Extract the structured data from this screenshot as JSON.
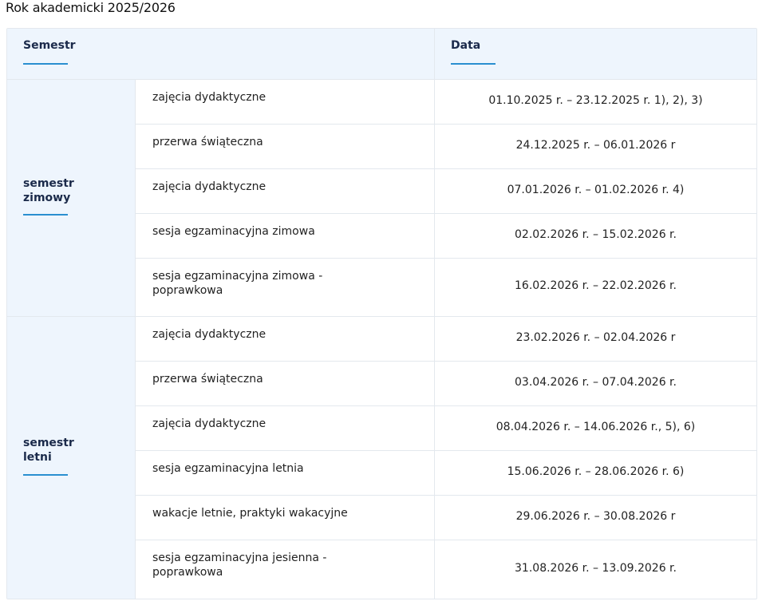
{
  "page_title": "Rok akademicki 2025/2026",
  "table": {
    "headers": {
      "semestr": "Semestr",
      "data": "Data"
    },
    "semesters": [
      {
        "name": "semestr\nzimowy",
        "rows": [
          {
            "activity": "zajęcia dydaktyczne",
            "date": "01.10.2025 r. – 23.12.2025 r. 1), 2), 3)"
          },
          {
            "activity": "przerwa świąteczna",
            "date": "24.12.2025 r. – 06.01.2026 r"
          },
          {
            "activity": "zajęcia dydaktyczne",
            "date": "07.01.2026 r. – 01.02.2026 r. 4)"
          },
          {
            "activity": "sesja egzaminacyjna zimowa",
            "date": "02.02.2026 r. – 15.02.2026 r."
          },
          {
            "activity": "sesja egzaminacyjna zimowa - poprawkowa",
            "date": "16.02.2026 r. – 22.02.2026 r."
          }
        ]
      },
      {
        "name": "semestr\nletni",
        "rows": [
          {
            "activity": "zajęcia dydaktyczne",
            "date": "23.02.2026 r. – 02.04.2026 r"
          },
          {
            "activity": "przerwa świąteczna",
            "date": "03.04.2026 r. – 07.04.2026 r."
          },
          {
            "activity": "zajęcia dydaktyczne",
            "date": "08.04.2026 r. – 14.06.2026 r., 5), 6)"
          },
          {
            "activity": "sesja egzaminacyjna letnia",
            "date": "15.06.2026 r. – 28.06.2026 r. 6)"
          },
          {
            "activity": "wakacje letnie, praktyki wakacyjne",
            "date": "29.06.2026 r. – 30.08.2026 r"
          },
          {
            "activity": "sesja egzaminacyjna jesienna - poprawkowa",
            "date": "31.08.2026 r. – 13.09.2026 r."
          }
        ]
      }
    ]
  }
}
